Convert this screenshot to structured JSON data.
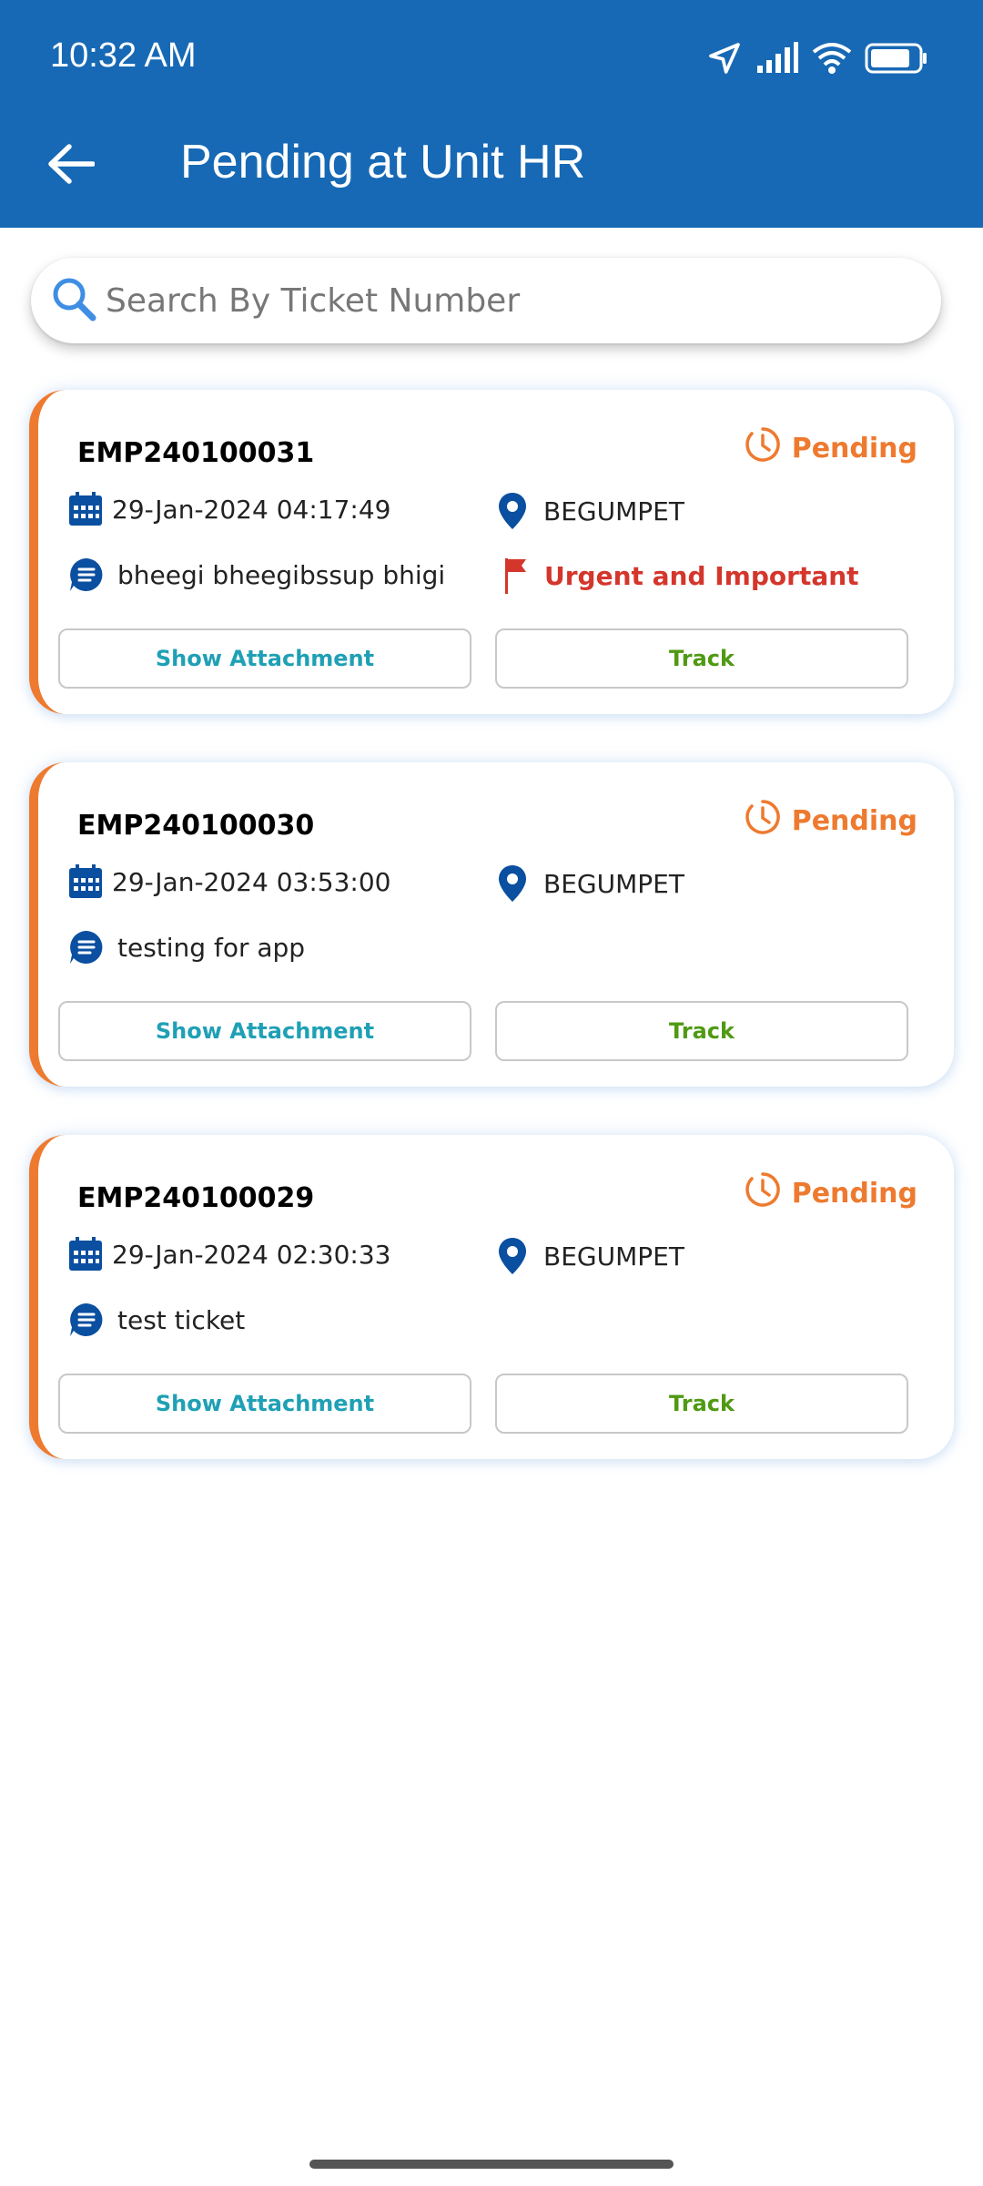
{
  "status_bar": {
    "time": "10:32 AM",
    "icons": [
      "location-arrow-icon",
      "signal-icon",
      "wifi-icon",
      "battery-icon"
    ]
  },
  "toolbar": {
    "title": "Pending at Unit HR",
    "back_icon": "back-arrow-icon"
  },
  "search": {
    "placeholder": "Search By Ticket Number",
    "value": ""
  },
  "tickets": [
    {
      "id": "EMP240100031",
      "status": "Pending",
      "datetime": "29-Jan-2024 04:17:49",
      "location": "BEGUMPET",
      "description": "bheegi bheegibssup bhigi",
      "priority": "Urgent and Important",
      "attachment_label": "Show Attachment",
      "track_label": "Track"
    },
    {
      "id": "EMP240100030",
      "status": "Pending",
      "datetime": "29-Jan-2024 03:53:00",
      "location": "BEGUMPET",
      "description": "testing for app",
      "priority": "",
      "attachment_label": "Show Attachment",
      "track_label": "Track"
    },
    {
      "id": "EMP240100029",
      "status": "Pending",
      "datetime": "29-Jan-2024 02:30:33",
      "location": "BEGUMPET",
      "description": "test ticket",
      "priority": "",
      "attachment_label": "Show Attachment",
      "track_label": "Track"
    }
  ],
  "colors": {
    "header": "#1769b5",
    "accent_orange": "#ee7a2f",
    "icon_blue": "#0a4fa0",
    "priority_red": "#d4362c",
    "attachment_teal": "#1fa0b5",
    "track_green": "#4f9a13"
  }
}
